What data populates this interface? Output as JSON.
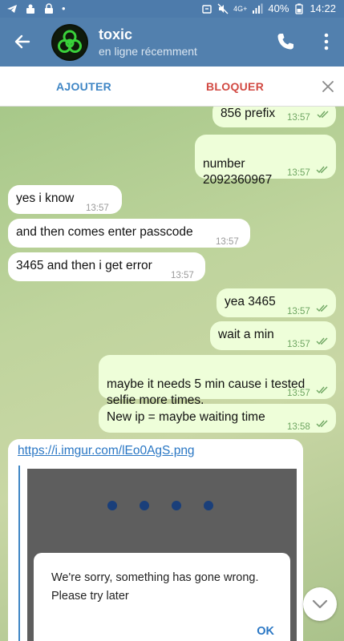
{
  "status_bar": {
    "battery": "40%",
    "time": "14:22",
    "network": "4G+"
  },
  "header": {
    "title": "toxic",
    "subtitle": "en ligne récemment"
  },
  "action_bar": {
    "add_label": "AJOUTER",
    "block_label": "BLOQUER"
  },
  "messages": [
    {
      "dir": "out",
      "text": "856 prefix",
      "time": "13:57"
    },
    {
      "dir": "out",
      "text": "number\n2092360967",
      "time": "13:57"
    },
    {
      "dir": "in",
      "text": "yes i know",
      "time": "13:57"
    },
    {
      "dir": "in",
      "text": "and then comes enter passcode",
      "time": "13:57"
    },
    {
      "dir": "in",
      "text": "3465 and then i get error",
      "time": "13:57"
    },
    {
      "dir": "out",
      "text": "yea 3465",
      "time": "13:57"
    },
    {
      "dir": "out",
      "text": "wait a min",
      "time": "13:57"
    },
    {
      "dir": "out",
      "text": "maybe it needs 5 min cause i tested\nselfie more times.",
      "time": "13:57"
    },
    {
      "dir": "out",
      "text": "New ip = maybe waiting time",
      "time": "13:58"
    }
  ],
  "link_message": {
    "url": "https://i.imgur.com/lEo0AgS.png",
    "preview_dialog_text": "We're sorry, something has gone wrong. Please try later",
    "preview_dialog_button": "OK"
  },
  "colors": {
    "header": "#5280ae",
    "outgoing_bubble": "#eefed9",
    "incoming_bubble": "#ffffff",
    "check": "#6fa662",
    "link": "#2a77c4",
    "block": "#d24a43"
  }
}
